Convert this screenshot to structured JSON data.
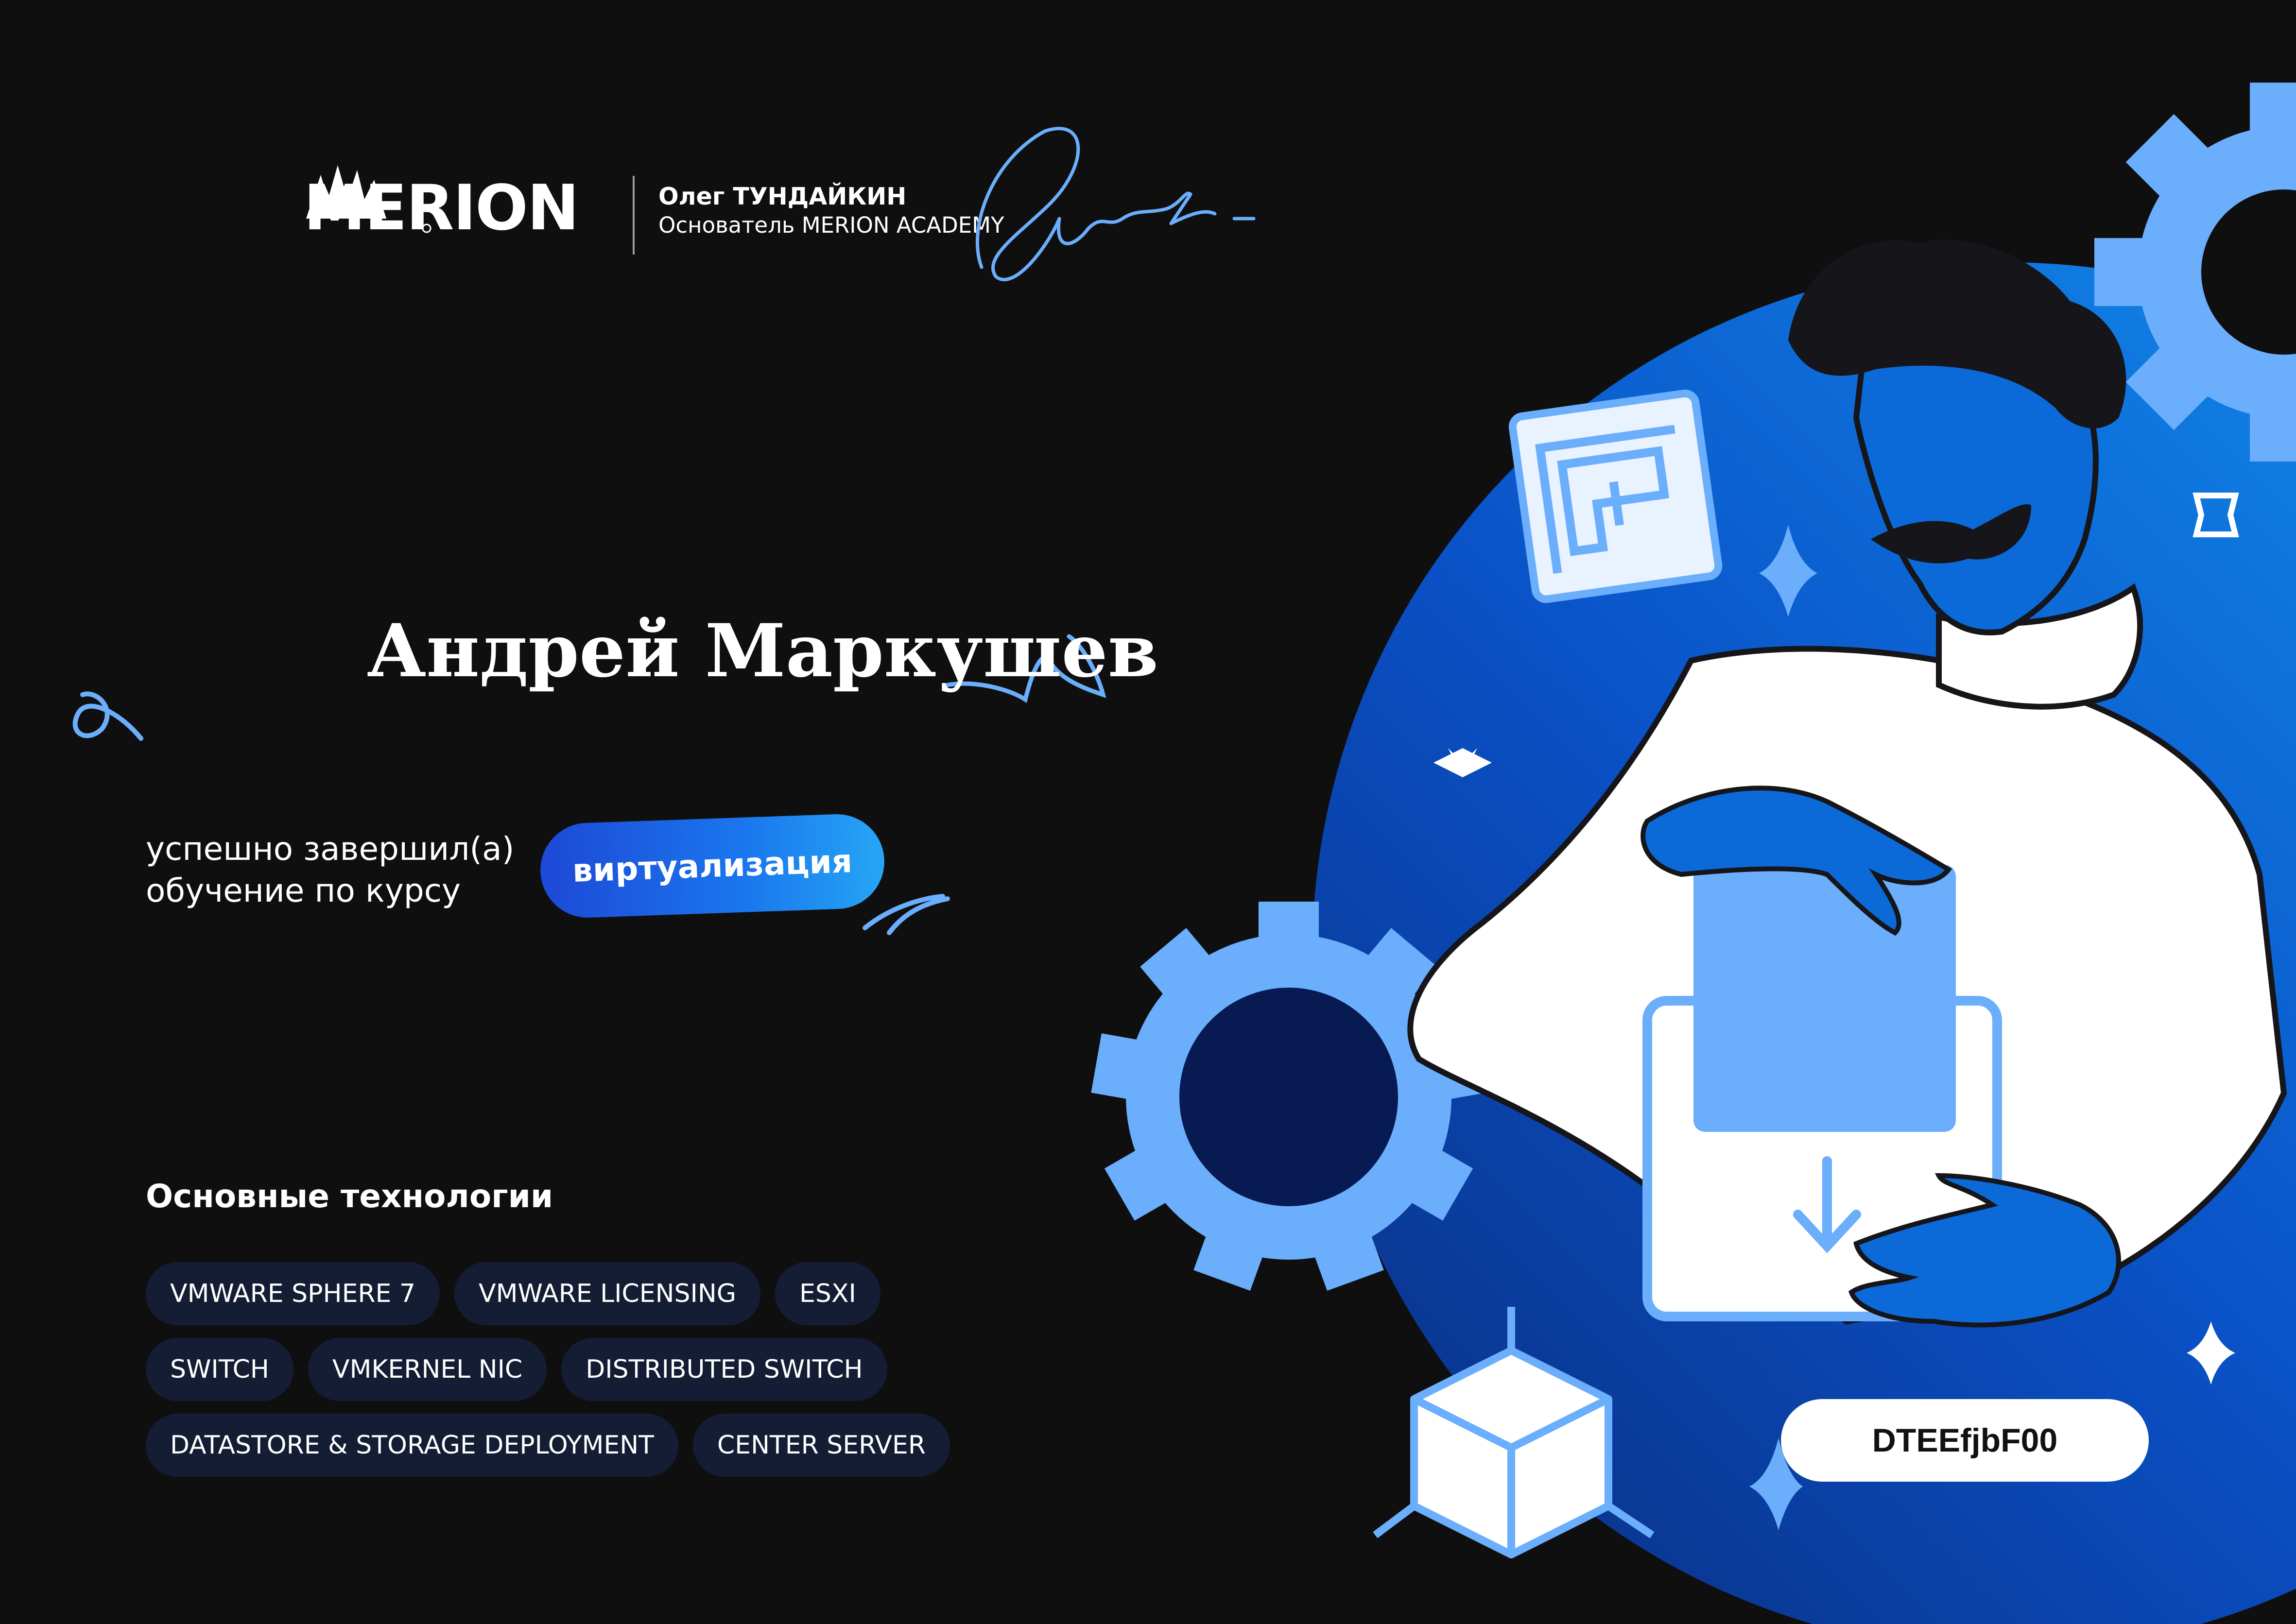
{
  "brand": {
    "logo_text": "MERION"
  },
  "founder": {
    "name": "Олег ТУНДАЙКИН",
    "role": "Основатель MERION ACADEMY"
  },
  "certificate": {
    "student_name": "Андрей Маркушев",
    "completed_text_line1": "успешно завершил(а)",
    "completed_text_line2": "обучение по курсу",
    "course_name": "виртуализация",
    "certificate_code": "DTEEfjbF00"
  },
  "technologies": {
    "heading": "Основные технологии",
    "rows": [
      [
        "VMWARE SPHERE 7",
        "VMWARE LICENSING",
        "ESXI"
      ],
      [
        "SWITCH",
        "VMKERNEL NIC",
        "DISTRIBUTED SWITCH"
      ],
      [
        "DATASTORE & STORAGE DEPLOYMENT",
        "CENTER SERVER"
      ]
    ]
  },
  "colors": {
    "background": "#0f0f10",
    "accent_blue": "#1a77ee",
    "light_blue": "#6aaefc",
    "chip_background": "#141d33"
  }
}
